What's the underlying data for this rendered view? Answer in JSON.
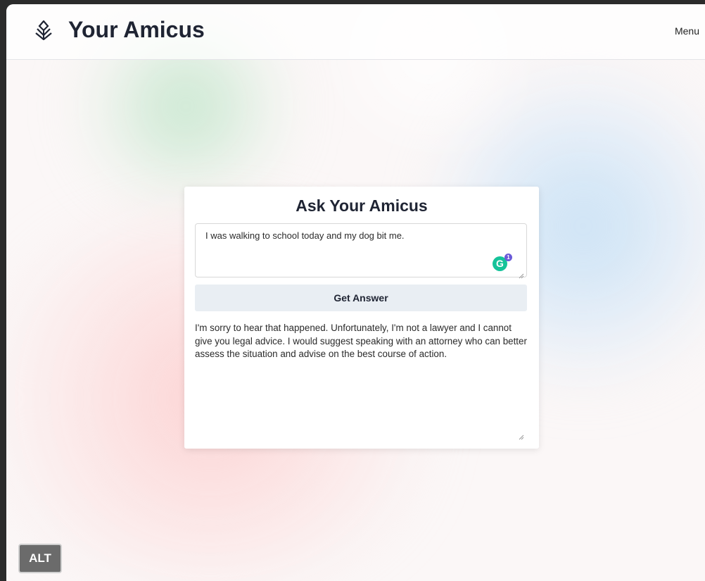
{
  "header": {
    "brand": "Your Amicus",
    "logo_icon": "amicus-logo-icon",
    "menu_label": "Menu"
  },
  "card": {
    "title": "Ask Your Amicus",
    "question_value": "I was walking to school today and my dog bit me.",
    "button_label": "Get Answer",
    "answer": "I'm sorry to hear that happened. Unfortunately, I'm not a lawyer and I cannot give you legal advice. I would suggest speaking with an attorney who can better assess the situation and advise on the best course of action.",
    "grammarly": {
      "icon": "grammarly-icon",
      "letter": "G",
      "count": "1"
    }
  },
  "overlay": {
    "alt_label": "ALT"
  },
  "colors": {
    "brand_text": "#1f2433",
    "button_bg": "#e9eef3",
    "grammarly": "#15c39a"
  }
}
